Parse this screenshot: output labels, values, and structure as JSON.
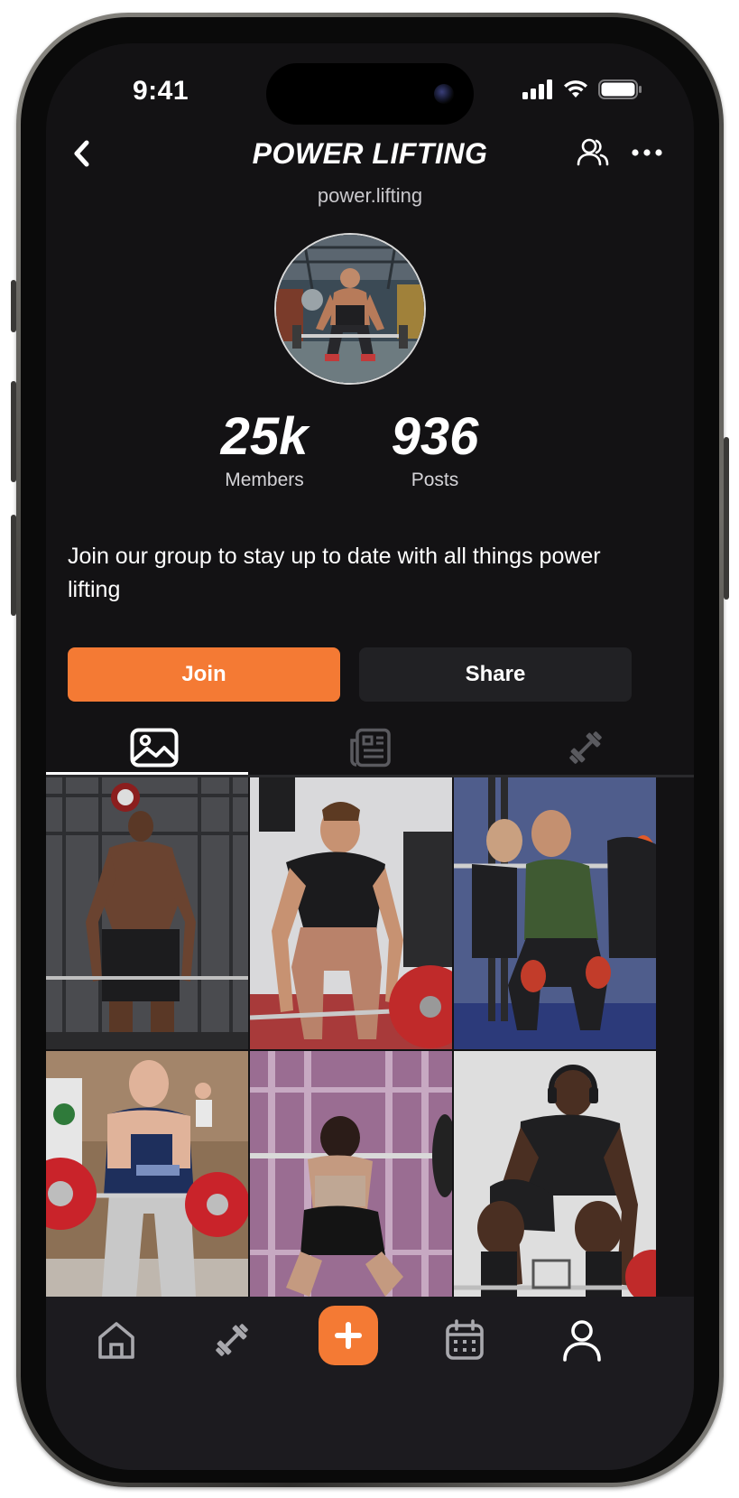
{
  "status_bar": {
    "time": "9:41"
  },
  "header": {
    "title": "POWER LIFTING",
    "handle": "power.lifting",
    "icons": [
      "back-icon",
      "members-icon",
      "more-icon"
    ]
  },
  "stats": [
    {
      "value": "25k",
      "label": "Members"
    },
    {
      "value": "936",
      "label": "Posts"
    }
  ],
  "description": "Join our group to stay up to date with all things power lifting",
  "actions": {
    "join_label": "Join",
    "share_label": "Share"
  },
  "tabs": [
    {
      "icon": "image-icon",
      "active": true
    },
    {
      "icon": "feed-icon",
      "active": false
    },
    {
      "icon": "dumbbell-icon",
      "active": false
    }
  ],
  "posts": [
    {
      "subject": "athlete-standing"
    },
    {
      "subject": "deadlift-setup"
    },
    {
      "subject": "squat-with-spotters"
    },
    {
      "subject": "heavy-deadlift"
    },
    {
      "subject": "back-squat"
    },
    {
      "subject": "deadlift-grip"
    }
  ],
  "bottom_nav": [
    "home-icon",
    "dumbbell-icon",
    "add-icon",
    "calendar-icon",
    "profile-icon"
  ],
  "colors": {
    "accent": "#f47a34",
    "background": "#131214",
    "surface": "#212124"
  }
}
